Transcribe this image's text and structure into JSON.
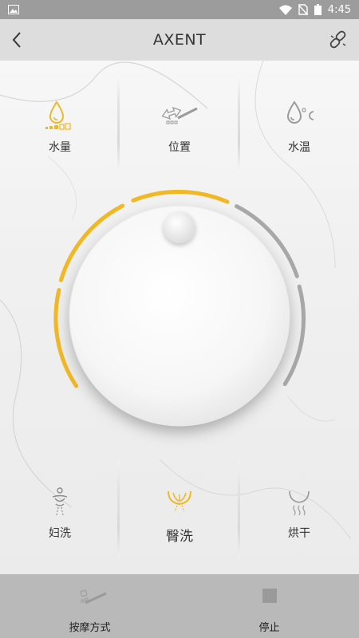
{
  "status_bar": {
    "time": "4:45"
  },
  "app_bar": {
    "title": "AXENT"
  },
  "top_options": [
    {
      "label": "水量",
      "icon": "water-volume-icon",
      "color": "#f2b824"
    },
    {
      "label": "位置",
      "icon": "nozzle-position-icon",
      "color": "#9a9a9a"
    },
    {
      "label": "水温",
      "icon": "water-temperature-icon",
      "color": "#9a9a9a"
    }
  ],
  "bottom_options": [
    {
      "label": "妇洗",
      "icon": "feminine-wash-icon",
      "active": false
    },
    {
      "label": "臀洗",
      "icon": "rear-wash-icon",
      "active": true
    },
    {
      "label": "烘干",
      "icon": "dryer-icon",
      "active": false
    }
  ],
  "dial": {
    "level_active_arcs": 2,
    "total_arcs": 4,
    "accent_color": "#f2b824",
    "inactive_color": "#a8a8a8"
  },
  "bottom_bar": {
    "massage_label": "按摩方式",
    "stop_label": "停止"
  }
}
